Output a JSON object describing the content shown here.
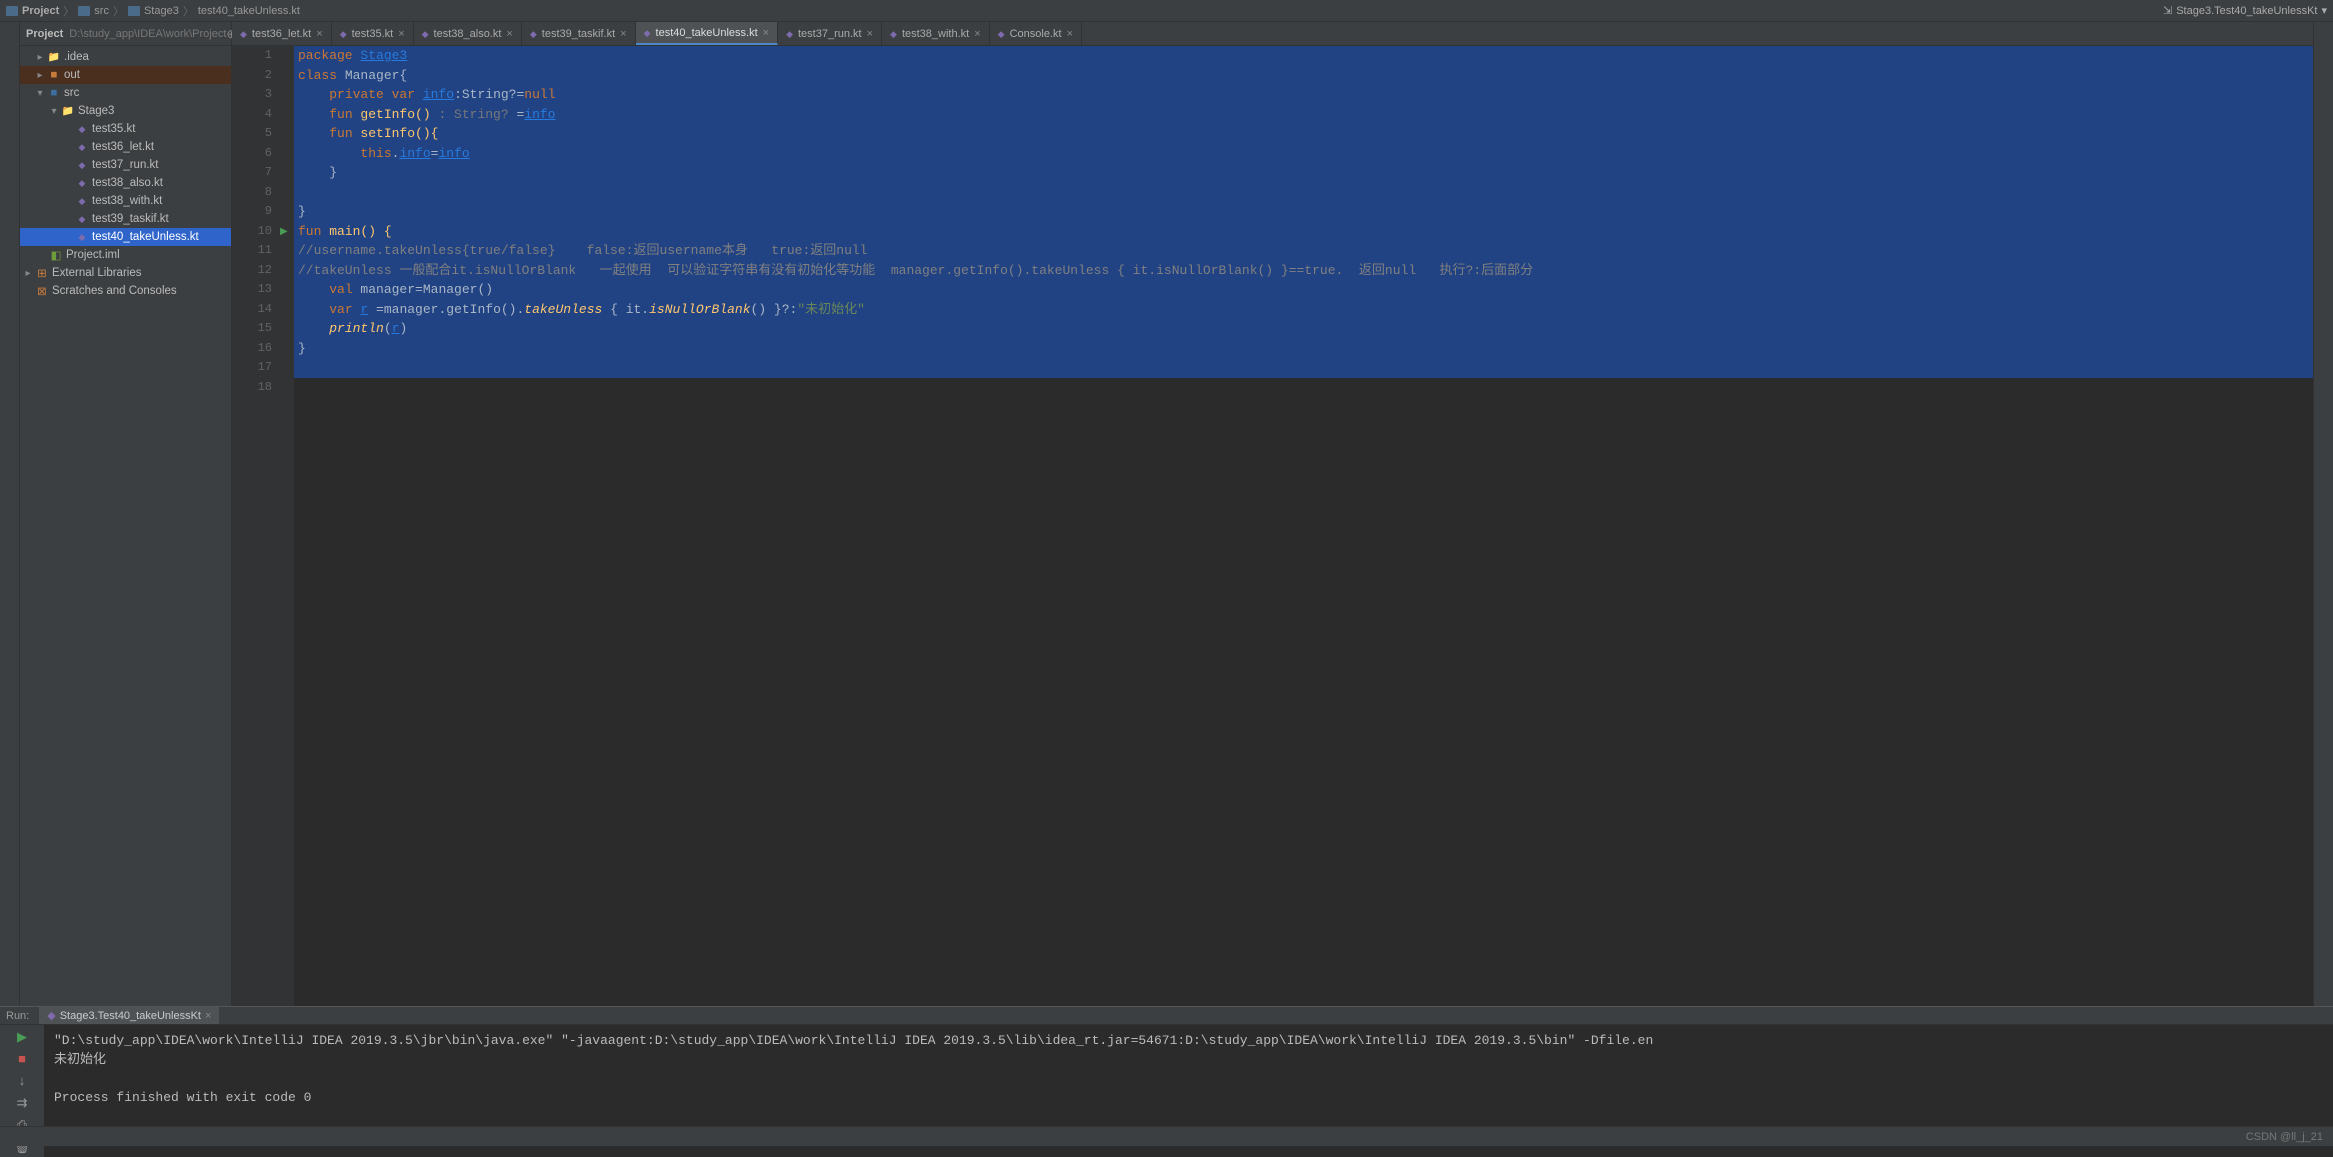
{
  "breadcrumbs": {
    "project": "Project",
    "src": "src",
    "stage": "Stage3",
    "file": "test40_takeUnless.kt"
  },
  "run_config": "Stage3.Test40_takeUnlessKt",
  "project_panel": {
    "title": "Project",
    "path": "D:\\study_app\\IDEA\\work\\Project",
    "tree": {
      "idea": ".idea",
      "out": "out",
      "src": "src",
      "stage3": "Stage3",
      "files": [
        "test35.kt",
        "test36_let.kt",
        "test37_run.kt",
        "test38_also.kt",
        "test38_with.kt",
        "test39_taskif.kt",
        "test40_takeUnless.kt"
      ],
      "iml": "Project.iml",
      "external": "External Libraries",
      "scratches": "Scratches and Consoles"
    }
  },
  "editor_tabs": [
    {
      "label": "test36_let.kt",
      "active": false
    },
    {
      "label": "test35.kt",
      "active": false
    },
    {
      "label": "test38_also.kt",
      "active": false
    },
    {
      "label": "test39_taskif.kt",
      "active": false
    },
    {
      "label": "test40_takeUnless.kt",
      "active": true
    },
    {
      "label": "test37_run.kt",
      "active": false
    },
    {
      "label": "test38_with.kt",
      "active": false
    },
    {
      "label": "Console.kt",
      "active": false
    }
  ],
  "code": {
    "line_count": 18,
    "lines": {
      "l1": {
        "keyword": "package",
        "link": "Stage3"
      },
      "l2": {
        "keyword": "class",
        "name": " Manager{"
      },
      "l3": {
        "kw1": "private var",
        "link": "info",
        "rest": ":String?=",
        "kw2": "null"
      },
      "l4": {
        "kw1": "fun",
        "name": " getInfo()",
        "hint": " : String? ",
        "eq": "=",
        "link": "info"
      },
      "l5": {
        "kw1": "fun",
        "name": " setInfo(){"
      },
      "l6": {
        "kw1": "this",
        "dot": ".",
        "link1": "info",
        "eq": "=",
        "link2": "info"
      },
      "l7": {
        "brace": "}"
      },
      "l8": {
        "empty": ""
      },
      "l9": {
        "brace": "}"
      },
      "l10": {
        "kw1": "fun",
        "name": " main() {"
      },
      "l11": {
        "comment": "//username.takeUnless{true/false}    false:返回username本身   true:返回null"
      },
      "l12": {
        "comment": "//takeUnless 一般配合it.isNullOrBlank   一起使用  可以验证字符串有没有初始化等功能  manager.getInfo().takeUnless { it.isNullOrBlank() }==true.  返回null   执行?:后面部分"
      },
      "l13": {
        "kw1": "val",
        "name": " manager=Manager()"
      },
      "l14": {
        "kw1": "var",
        "link": "r",
        "rest": " =manager.getInfo().",
        "func": "takeUnless",
        "rest2": " { it.",
        "func2": "isNullOrBlank",
        "rest3": "() }?:",
        "str": "\"未初始化\""
      },
      "l15": {
        "func": "println",
        "paren": "(",
        "link": "r",
        "paren2": ")"
      },
      "l16": {
        "brace": "}"
      }
    }
  },
  "run_panel": {
    "label": "Run:",
    "tab": "Stage3.Test40_takeUnlessKt",
    "output": {
      "cmd": "\"D:\\study_app\\IDEA\\work\\IntelliJ IDEA 2019.3.5\\jbr\\bin\\java.exe\" \"-javaagent:D:\\study_app\\IDEA\\work\\IntelliJ IDEA 2019.3.5\\lib\\idea_rt.jar=54671:D:\\study_app\\IDEA\\work\\IntelliJ IDEA 2019.3.5\\bin\" -Dfile.en",
      "result": "未初始化",
      "exit": "Process finished with exit code 0"
    }
  },
  "status_bar": {
    "watermark": "CSDN @ll_j_21"
  }
}
